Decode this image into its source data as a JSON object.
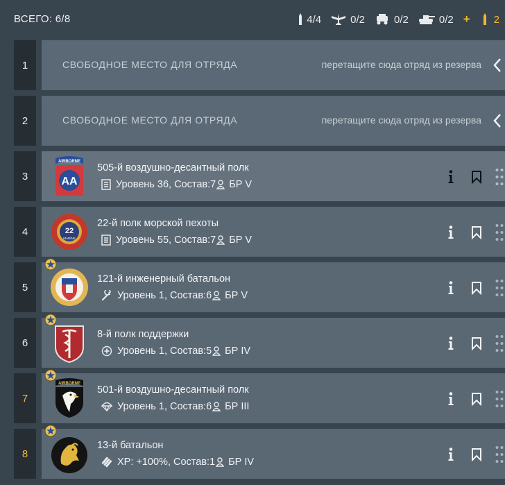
{
  "header": {
    "total_label": "ВСЕГО: 6/8",
    "counters": [
      {
        "icon": "rifle-bullet-icon",
        "value": "4/4"
      },
      {
        "icon": "aircraft-icon",
        "value": "0/2"
      },
      {
        "icon": "vehicle-icon",
        "value": "0/2"
      },
      {
        "icon": "tank-icon",
        "value": "0/2"
      }
    ],
    "plus_label": "+",
    "gold_count": "2"
  },
  "slots": [
    {
      "number": "1",
      "empty": true,
      "title": "СВОБОДНОЕ МЕСТО ДЛЯ ОТРЯДА",
      "hint": "перетащите сюда отряд из резерва"
    },
    {
      "number": "2",
      "empty": true,
      "title": "СВОБОДНОЕ МЕСТО ДЛЯ ОТРЯДА",
      "hint": "перетащите сюда отряд из резерва"
    },
    {
      "number": "3",
      "name": "505-й воздушно-десантный полк",
      "stats": "Уровень 36, Состав:7",
      "br": "БР V",
      "stat_icon": "rank-icon",
      "emblem": "airborne-aa-emblem"
    },
    {
      "number": "4",
      "name": "22-й полк морской пехоты",
      "stats": "Уровень 55, Состав:7",
      "br": "БР V",
      "stat_icon": "rank-icon",
      "emblem": "marine-22-emblem"
    },
    {
      "number": "5",
      "name": "121-й инженерный батальон",
      "stats": "Уровень 1, Состав:6",
      "br": "БР V",
      "stat_icon": "wrench-icon",
      "emblem": "engineer-shield-emblem"
    },
    {
      "number": "6",
      "name": "8-й полк поддержки",
      "stats": "Уровень 1, Состав:5",
      "br": "БР IV",
      "stat_icon": "medic-plus-icon",
      "emblem": "medical-caduceus-emblem"
    },
    {
      "number": "7",
      "name": "501-й воздушно-десантный полк",
      "stats": "Уровень 1, Состав:6",
      "br": "БР III",
      "stat_icon": "parachute-icon",
      "emblem": "eagle-airborne-emblem"
    },
    {
      "number": "8",
      "name": "13-й батальон",
      "stats": "XP: +100%, Состав:1",
      "br": "БР IV",
      "stat_icon": "xp-ammo-icon",
      "emblem": "lion-emblem"
    }
  ],
  "emblem_text": {
    "airborne": "AIRBORNE",
    "marine_number": "22",
    "marine_word": "MARINE"
  },
  "colors": {
    "gold": "#f1b73a",
    "card": "#5a6874",
    "card_active": "#66737f",
    "slot_number_bg": "#262e34"
  }
}
